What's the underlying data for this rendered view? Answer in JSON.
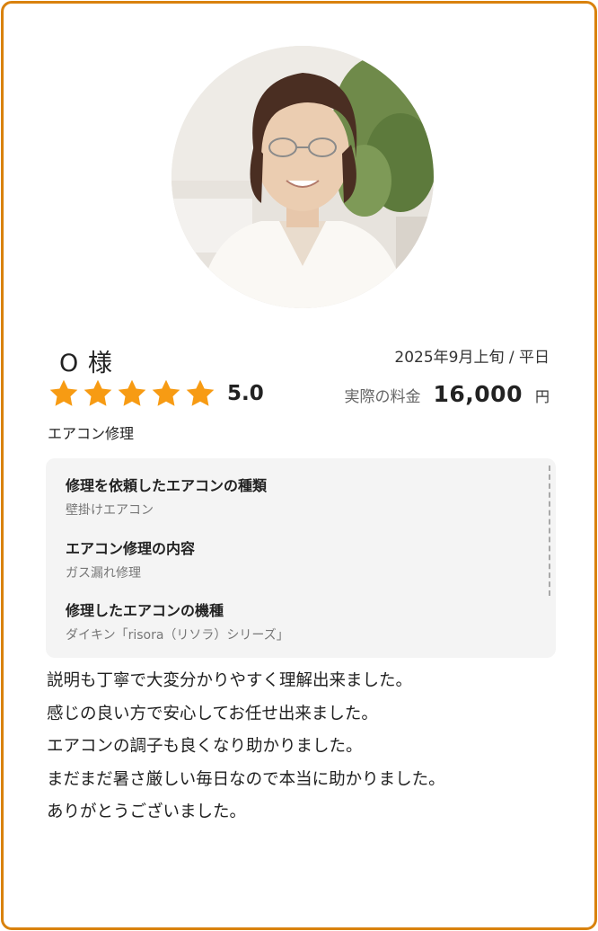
{
  "review": {
    "customer_name": "O 様",
    "date": "2025年9月上旬 / 平日",
    "rating": {
      "stars": 5,
      "value_label": "5.0",
      "star_color": "#f79b13"
    },
    "price": {
      "label": "実際の料金",
      "amount": "16,000",
      "unit": "円"
    },
    "service": "エアコン修理",
    "details": [
      {
        "question": "修理を依頼したエアコンの種類",
        "answer": "壁掛けエアコン"
      },
      {
        "question": "エアコン修理の内容",
        "answer": "ガス漏れ修理"
      },
      {
        "question": "修理したエアコンの機種",
        "answer": "ダイキン「risora（リソラ）シリーズ」"
      }
    ],
    "comment_lines": [
      "説明も丁寧で大変分かりやすく理解出来ました。",
      "感じの良い方で安心してお任せ出来ました。",
      "エアコンの調子も良くなり助かりました。",
      "まだまだ暑さ厳しい毎日なので本当に助かりました。",
      "ありがとうございました。"
    ]
  },
  "colors": {
    "border": "#d9820e",
    "detail_background": "#f4f4f4",
    "star": "#f79b13"
  },
  "icons": {
    "avatar": "customer-photo",
    "star": "star-icon"
  }
}
